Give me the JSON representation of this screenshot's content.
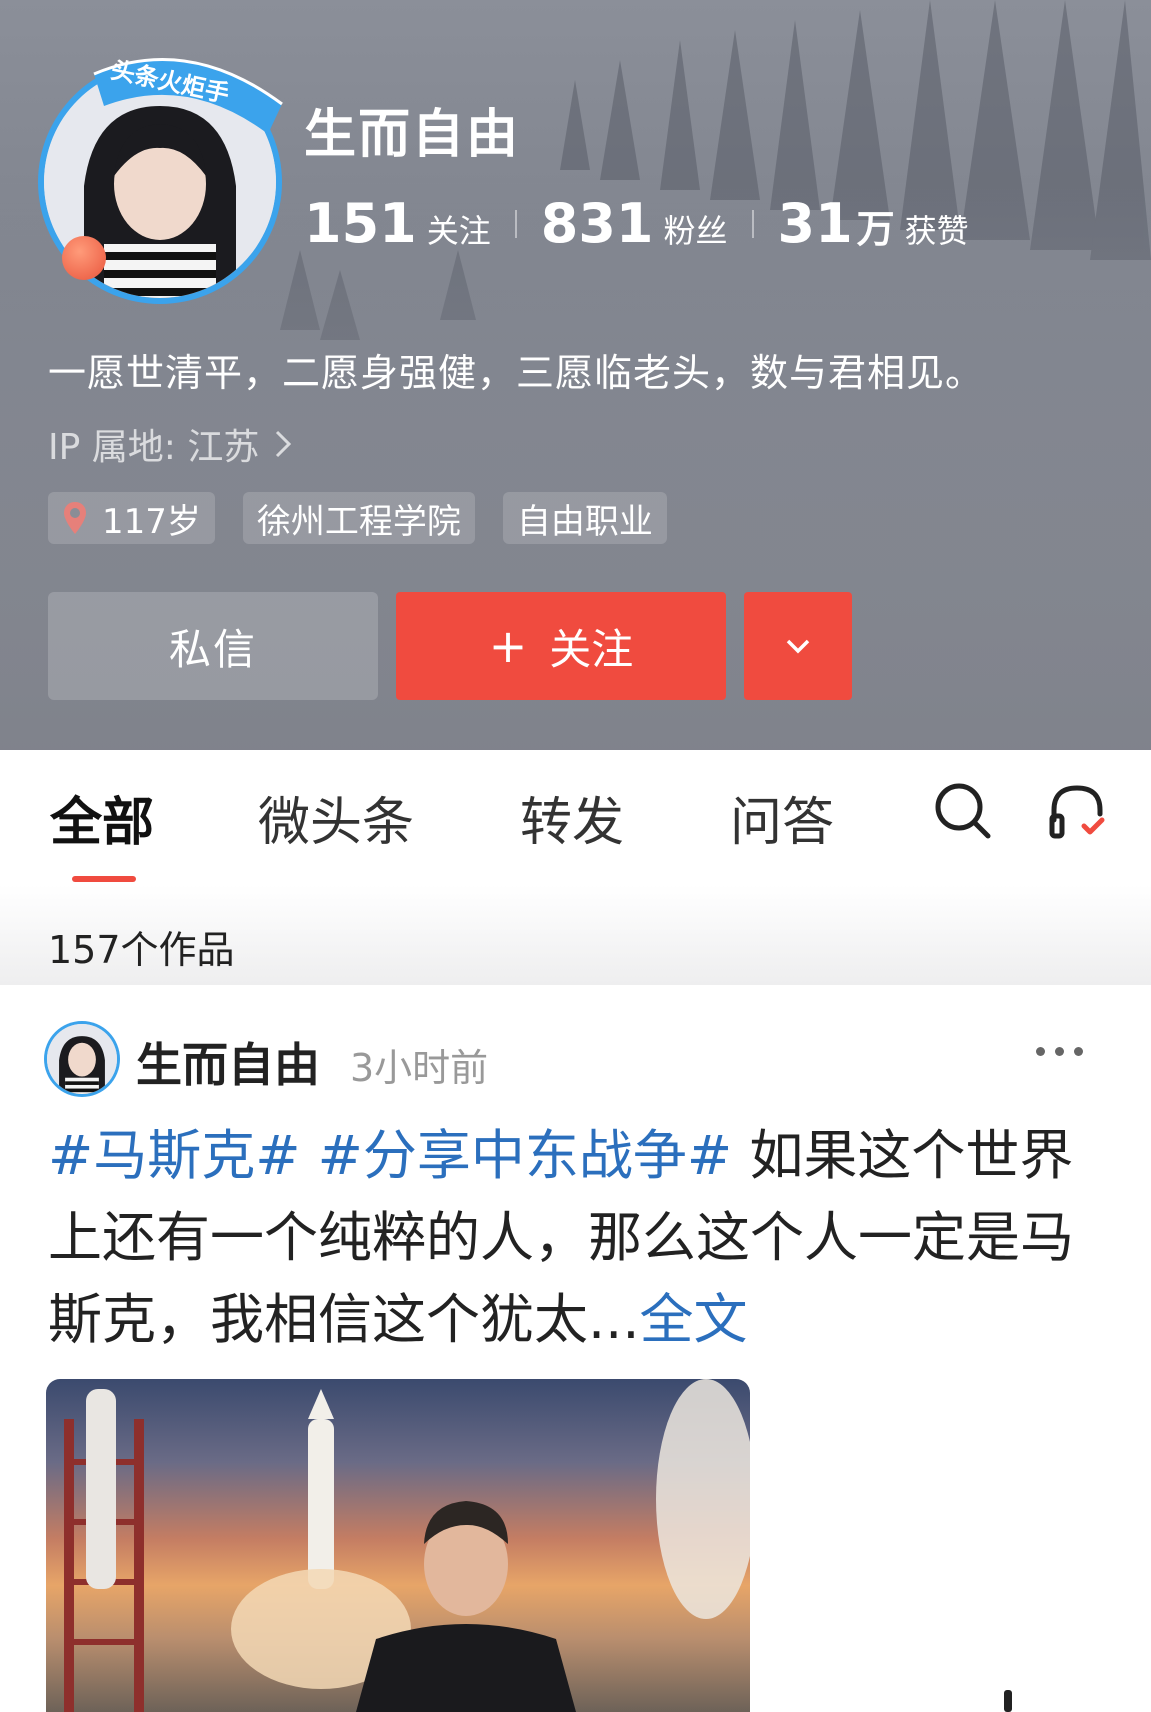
{
  "profile": {
    "badge_text": "头条火炬手",
    "name": "生而自由",
    "stats": [
      {
        "num": "151",
        "unit": "",
        "label": "关注"
      },
      {
        "num": "831",
        "unit": "",
        "label": "粉丝"
      },
      {
        "num": "31",
        "unit": "万",
        "label": "获赞"
      }
    ],
    "bio": "一愿世清平，二愿身强健，三愿临老头，数与君相见。",
    "ip": "IP 属地: 江苏",
    "tags": [
      "117岁",
      "徐州工程学院",
      "自由职业"
    ]
  },
  "actions": {
    "message_label": "私信",
    "follow_plus": "+",
    "follow_label": "关注"
  },
  "tabs": {
    "items": [
      "全部",
      "微头条",
      "转发",
      "问答"
    ],
    "active_index": 0
  },
  "works_count": "157个作品",
  "post": {
    "author": "生而自由",
    "time": "3小时前",
    "hashtag1": "#马斯克#",
    "hashtag2": "#分享中东战争#",
    "text": " 如果这个世界上还有一个纯粹的人，那么这个人一定是马斯克，我相信这个犹太...",
    "read_more": "全文"
  },
  "colors": {
    "accent_red": "#f04b3f",
    "link_blue": "#2b6fbd",
    "badge_blue": "#3ba3ec"
  },
  "icons": [
    "location-pin-icon",
    "chevron-right-icon",
    "chevron-down-icon",
    "search-icon",
    "headset-icon",
    "more-dots-icon"
  ]
}
